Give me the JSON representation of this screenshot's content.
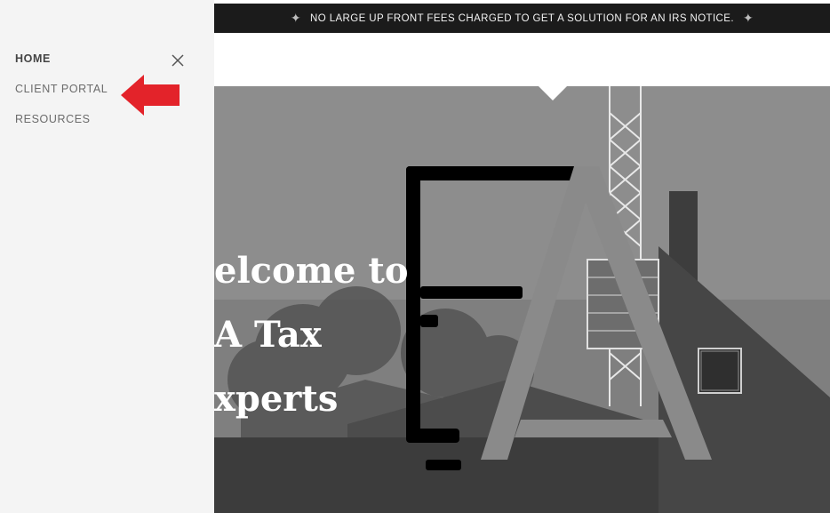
{
  "announcement": {
    "text": "NO LARGE UP FRONT FEES CHARGED TO GET A SOLUTION FOR AN IRS NOTICE.",
    "star_icon": "compass-star-icon"
  },
  "menu": {
    "items": [
      {
        "label": "HOME",
        "active": true
      },
      {
        "label": "CLIENT PORTAL",
        "active": false
      },
      {
        "label": "RESOURCES",
        "active": false
      }
    ],
    "close_icon": "close-icon",
    "pointer_icon": "red-arrow-icon",
    "pointer_color": "#e3232a"
  },
  "hero": {
    "title_lines": [
      "elcome to",
      "A Tax",
      "xperts"
    ]
  }
}
